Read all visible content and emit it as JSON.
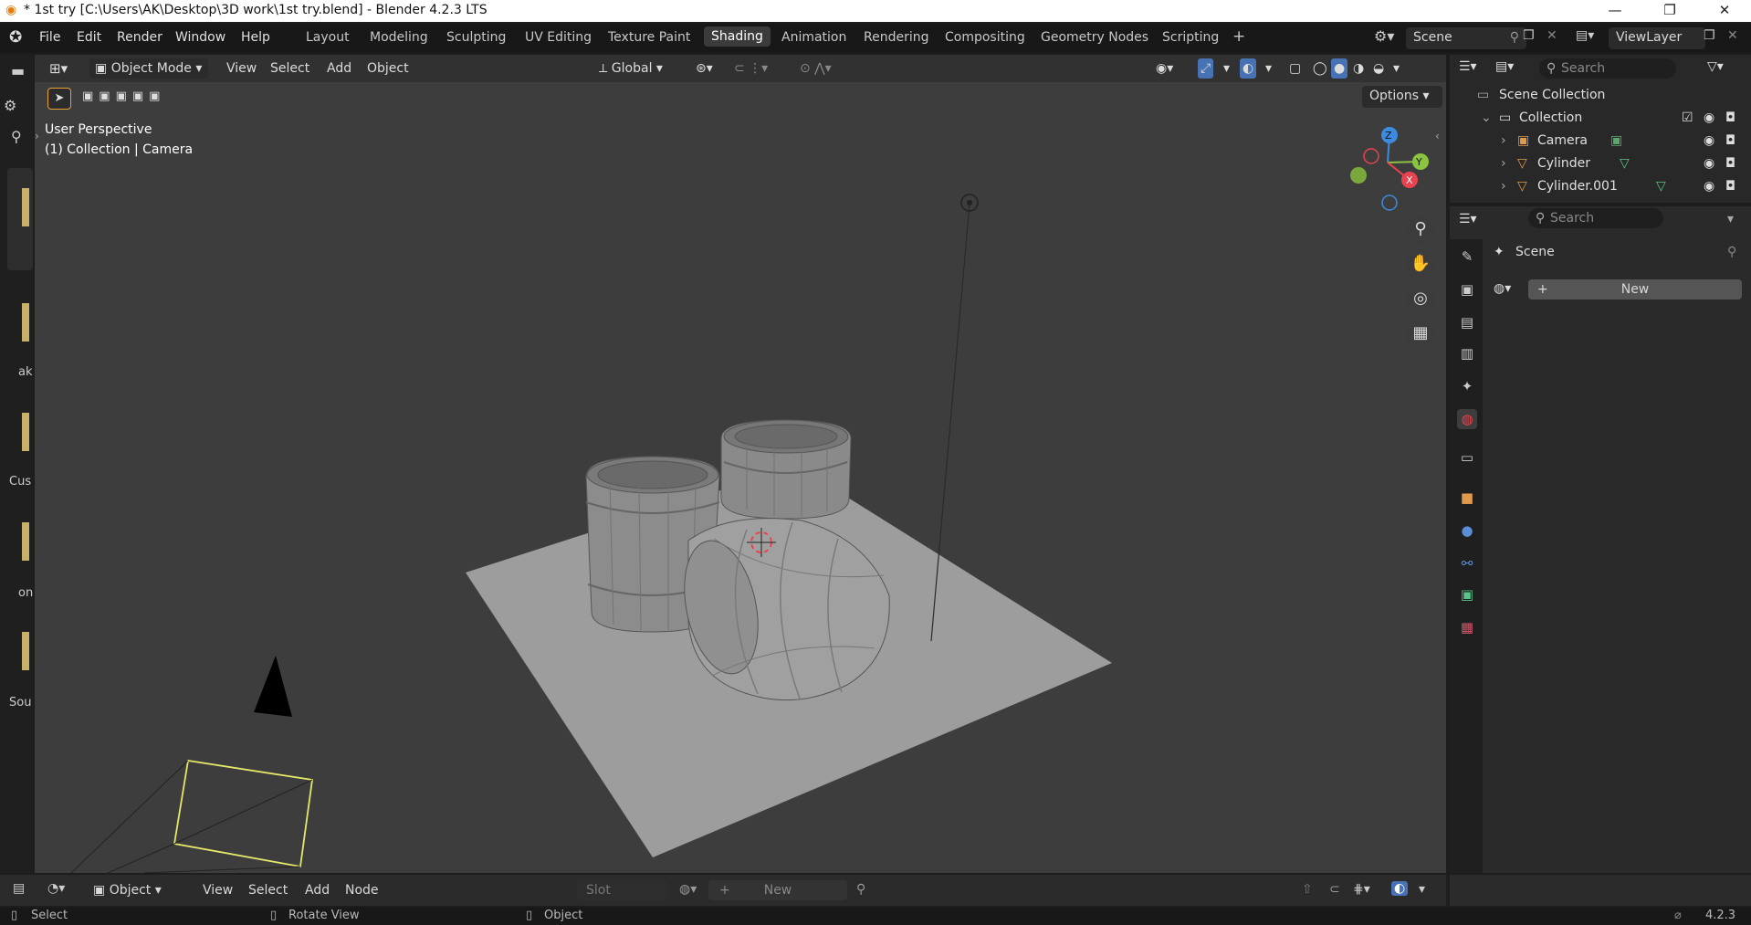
{
  "window": {
    "title": "* 1st try [C:\\Users\\AK\\Desktop\\3D work\\1st try.blend] - Blender 4.2.3 LTS"
  },
  "menu": [
    "File",
    "Edit",
    "Render",
    "Window",
    "Help"
  ],
  "workspaces": [
    "Layout",
    "Modeling",
    "Sculpting",
    "UV Editing",
    "Texture Paint",
    "Shading",
    "Animation",
    "Rendering",
    "Compositing",
    "Geometry Nodes",
    "Scripting"
  ],
  "active_workspace": "Shading",
  "scene": {
    "name": "Scene",
    "view_layer": "ViewLayer"
  },
  "viewport_header": {
    "mode": "Object Mode",
    "menus": [
      "View",
      "Select",
      "Add",
      "Object"
    ],
    "transform_orientation": "Global",
    "options_label": "Options"
  },
  "viewport": {
    "perspective_label": "User Perspective",
    "context_label": "(1) Collection | Camera",
    "gizmo_axes": [
      "Z",
      "Y",
      "X"
    ]
  },
  "outliner": {
    "search_placeholder": "Search",
    "root": "Scene Collection",
    "collection": "Collection",
    "items": [
      "Camera",
      "Cylinder",
      "Cylinder.001"
    ]
  },
  "properties": {
    "search_placeholder": "Search",
    "context": "Scene",
    "new_button": "New"
  },
  "left_strip_labels": [
    "ak",
    "Cus",
    "on",
    "Sou"
  ],
  "node_editor": {
    "mode": "Object",
    "menus": [
      "View",
      "Select",
      "Add",
      "Node"
    ],
    "slot_label": "Slot",
    "new_button": "New"
  },
  "status_bar": {
    "hints": [
      "Select",
      "Rotate View",
      "Object"
    ],
    "version": "4.2.3"
  },
  "colors": {
    "accent": "#4772b3",
    "viewport_bg": "#3d3d3d",
    "camera_frame": "#e5e86a",
    "axis_x": "#e8434f",
    "axis_y": "#8bc53f",
    "axis_z": "#3d8be0"
  }
}
